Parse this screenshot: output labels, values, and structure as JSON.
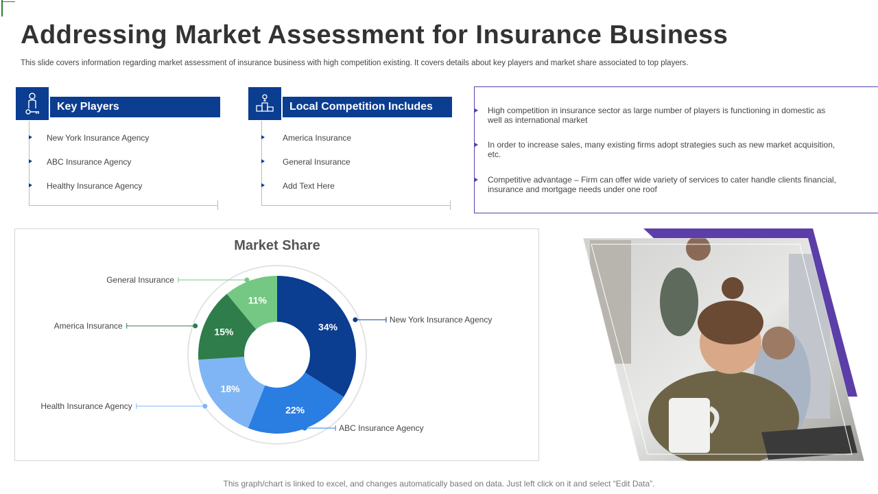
{
  "slide": {
    "title": "Addressing Market Assessment for Insurance Business",
    "subtitle": "This slide covers information regarding market assessment of insurance business with high competition existing. It covers details about key players and market share associated to top players.",
    "footer": "This graph/chart is linked to excel, and changes automatically based on data. Just left click on it and select “Edit Data”."
  },
  "key_players": {
    "heading": "Key Players",
    "icon": "person-key-icon",
    "items": [
      "New York Insurance Agency",
      "ABC Insurance Agency",
      "Healthy Insurance Agency"
    ]
  },
  "local_competition": {
    "heading": "Local Competition Includes",
    "icon": "podium-icon",
    "items": [
      "America Insurance",
      "General Insurance",
      "Add Text Here"
    ]
  },
  "insights": {
    "items": [
      "High competition in insurance sector as large number of players is functioning in domestic as well as international market",
      "In order to increase sales, many existing firms adopt strategies such as new market acquisition, etc.",
      "Competitive advantage – Firm can offer wide variety of services to cater handle clients financial, insurance and mortgage needs under one roof"
    ]
  },
  "photo": {
    "icon": "people-at-laptop-photo"
  },
  "colors": {
    "brand_blue": "#0b3d91",
    "accent_purple": "#5b3ea8"
  },
  "chart_data": {
    "type": "pie",
    "title": "Market Share",
    "donut": true,
    "categories": [
      "New York Insurance Agency",
      "ABC Insurance Agency",
      "Health Insurance Agency",
      "America Insurance",
      "General Insurance"
    ],
    "values": [
      34,
      22,
      18,
      15,
      11
    ],
    "labels": [
      "34%",
      "22%",
      "18%",
      "15%",
      "11%"
    ],
    "colors": [
      "#0b3d91",
      "#2a7de1",
      "#7fb5f5",
      "#2e7d4a",
      "#74c884"
    ]
  }
}
